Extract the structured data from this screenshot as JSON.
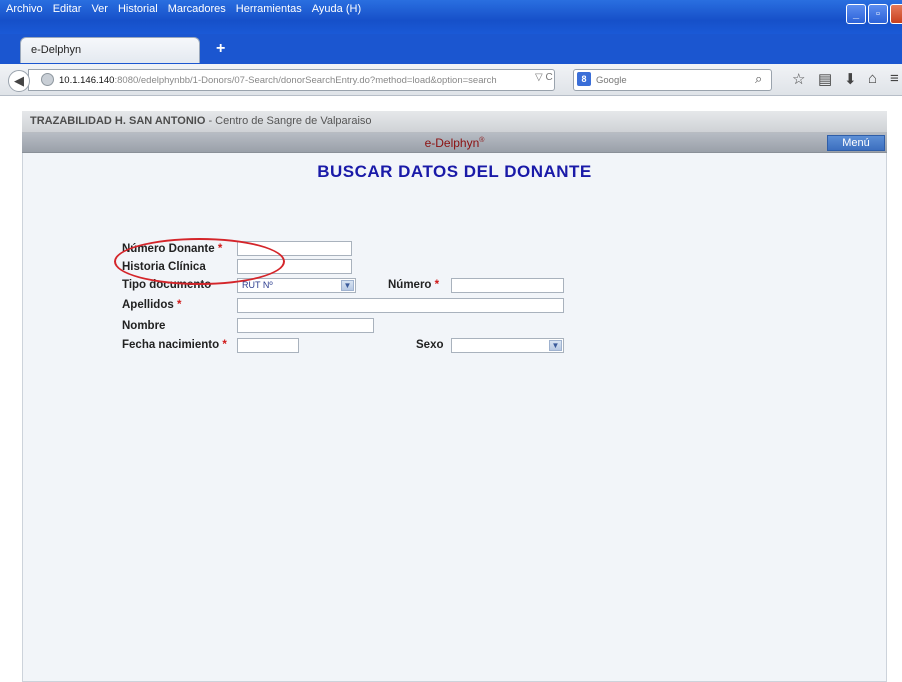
{
  "browser": {
    "menu": [
      {
        "label": "Archivo"
      },
      {
        "label": "Editar"
      },
      {
        "label": "Ver"
      },
      {
        "label": "Historial"
      },
      {
        "label": "Marcadores"
      },
      {
        "label": "Herramientas"
      },
      {
        "label": "Ayuda (H)"
      }
    ],
    "tab_title": "e-Delphyn",
    "new_tab": "+",
    "url_host": "10.1.146.140",
    "url_rest": ":8080/edelphynbb/1-Donors/07-Search/donorSearchEntry.do?method=load&option=search",
    "search_placeholder": "Google",
    "search_engine_badge": "8"
  },
  "app": {
    "org_name": "TRAZABILIDAD H. SAN ANTONIO",
    "org_sub": " - Centro de Sangre de Valparaiso",
    "product": "e-Delphyn",
    "product_mark": "®",
    "menu_button": "Menú",
    "page_title": "BUSCAR DATOS DEL DONANTE"
  },
  "form": {
    "numero_donante": {
      "label": "Número Donante",
      "required": "*",
      "value": ""
    },
    "historia_clinica": {
      "label": "Historia Clínica",
      "value": ""
    },
    "tipo_documento": {
      "label": "Tipo documento",
      "selected": "RUT Nº"
    },
    "numero": {
      "label": "Número",
      "required": "*",
      "value": ""
    },
    "apellidos": {
      "label": "Apellidos",
      "required": "*",
      "value": ""
    },
    "nombre": {
      "label": "Nombre",
      "value": ""
    },
    "fecha_nacimiento": {
      "label": "Fecha nacimiento",
      "required": "*",
      "value": ""
    },
    "sexo": {
      "label": "Sexo",
      "selected": ""
    }
  },
  "colors": {
    "title_blue": "#1a1aa8",
    "required_red": "#d01818",
    "annotation_red": "#d4252a",
    "brand_red": "#8b1010"
  }
}
